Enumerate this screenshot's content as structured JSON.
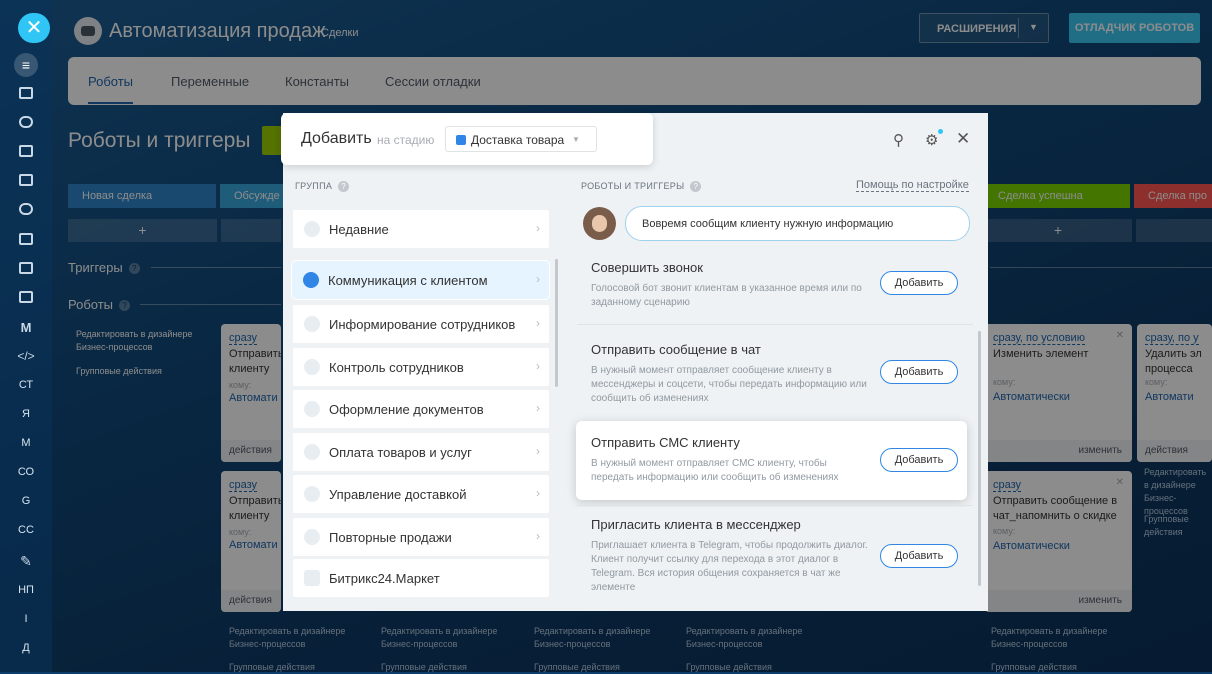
{
  "header": {
    "title": "Автоматизация продаж",
    "subtitle": "Сделки",
    "extensions": "РАСШИРЕНИЯ",
    "debugger": "ОТЛАДЧИК РОБОТОВ"
  },
  "rail": {
    "items": [
      "СТ",
      "Я",
      "М",
      "СО",
      "G",
      "СС",
      "НП",
      "I",
      "Д"
    ]
  },
  "tabs": [
    "Роботы",
    "Переменные",
    "Константы",
    "Сессии отладки"
  ],
  "section": {
    "title": "Роботы и триггеры",
    "triggers": "Триггеры",
    "robots": "Роботы"
  },
  "stages": [
    "Новая сделка",
    "Обсужде",
    "Сделка успешна",
    "Сделка про"
  ],
  "stage_colors": {
    "new": "#2f86c9",
    "discuss": "#39a8dd",
    "success": "#7bd500",
    "fail": "#ff5752"
  },
  "side_links": {
    "designer": "Редактировать в дизайнере Бизнес-процессов",
    "group": "Групповые действия"
  },
  "cards": {
    "c1": {
      "when": "сразу",
      "name": "Отправить клиенту",
      "who": "кому:",
      "auto": "Автомати",
      "foot": "действия"
    },
    "c2": {
      "when": "сразу",
      "name": "Отправить клиенту",
      "who": "кому:",
      "auto": "Автомати",
      "foot": "действия"
    },
    "c3": {
      "when": "сразу, по условию",
      "name": "Изменить элемент",
      "who": "кому:",
      "auto": "Автоматически",
      "foot": "изменить"
    },
    "c4": {
      "when": "сразу, по у",
      "name": "Удалить эл процесса",
      "who": "кому:",
      "auto": "Автомати",
      "foot": "действия"
    },
    "c5": {
      "when": "сразу",
      "name": "Отправить сообщение в чат_напомнить о скидке",
      "who": "кому:",
      "auto": "Автоматически",
      "foot": "изменить"
    }
  },
  "modal": {
    "title": "Добавить",
    "stage_label": "на стадию",
    "stage_value": "Доставка товара",
    "groups_header": "ГРУППА",
    "groups": [
      "Недавние",
      "Коммуникация с клиентом",
      "Информирование сотрудников",
      "Контроль сотрудников",
      "Оформление документов",
      "Оплата товаров и услуг",
      "Управление доставкой",
      "Повторные продажи",
      "Битрикс24.Маркет"
    ],
    "robots_header": "РОБОТЫ И ТРИГГЕРЫ",
    "help": "Помощь по настройке",
    "hint": "Вовремя сообщим клиенту нужную информацию",
    "add": "Добавить",
    "robots": [
      {
        "title": "Совершить звонок",
        "desc": "Голосовой бот звонит клиентам в указанное время или по заданному сценарию"
      },
      {
        "title": "Отправить сообщение в чат",
        "desc": "В нужный момент отправляет сообщение клиенту в мессенджеры и соцсети, чтобы передать информацию или сообщить об изменениях"
      },
      {
        "title": "Отправить СМС клиенту",
        "desc": "В нужный момент отправляет СМС клиенту, чтобы передать информацию или сообщить об изменениях"
      },
      {
        "title": "Пригласить клиента в мессенджер",
        "desc": "Приглашает клиента в Telegram, чтобы продолжить диалог. Клиент получит ссылку для перехода в этот диалог в Telegram. Вся история общения сохраняется в чат же элементе"
      }
    ]
  },
  "plus": "+",
  "close": "✕"
}
